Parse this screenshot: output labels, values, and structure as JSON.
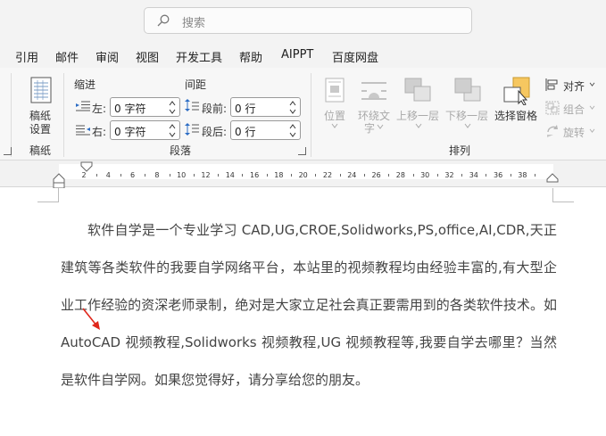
{
  "search": {
    "placeholder": "搜索"
  },
  "tabs": [
    "引用",
    "邮件",
    "审阅",
    "视图",
    "开发工具",
    "帮助",
    "AIPPT",
    "百度网盘"
  ],
  "ribbon": {
    "draft": {
      "button_line1": "稿纸",
      "button_line2": "设置",
      "group_label": "稿纸"
    },
    "paragraph": {
      "indent_header": "缩进",
      "spacing_header": "间距",
      "left_label": "左:",
      "right_label": "右:",
      "left_value": "0 字符",
      "right_value": "0 字符",
      "before_label": "段前:",
      "after_label": "段后:",
      "before_value": "0 行",
      "after_value": "0 行",
      "group_label": "段落"
    },
    "arrange": {
      "position": "位置",
      "wrap_line1": "环绕文",
      "wrap_line2": "字",
      "bring_forward": "上移一层",
      "send_backward": "下移一层",
      "selection_pane": "选择窗格",
      "align": "对齐",
      "group": "组合",
      "rotate": "旋转",
      "group_label": "排列"
    }
  },
  "ruler": {
    "ticks": [
      "2",
      "4",
      "6",
      "8",
      "10",
      "12",
      "14",
      "16",
      "18",
      "20",
      "22",
      "24",
      "26",
      "28",
      "30",
      "32",
      "34",
      "36",
      "38"
    ]
  },
  "document": {
    "paragraph": "软件自学是一个专业学习 CAD,UG,CROE,Solidworks,PS,office,AI,CDR,天正建筑等各类软件的我要自学网络平台，本站里的视频教程均由经验丰富的,有大型企业工作经验的资深老师录制，绝对是大家立足社会真正要需用到的各类软件技术。如 AutoCAD 视频教程,Solidworks 视频教程,UG 视频教程等,我要自学去哪里？当然是软件自学网。如果您觉得好，请分享给您的朋友。"
  }
}
